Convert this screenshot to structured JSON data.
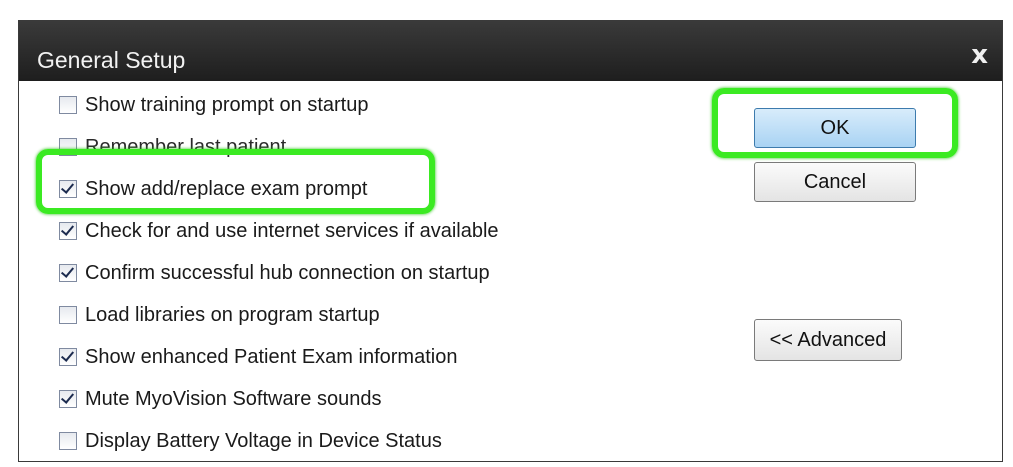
{
  "dialog": {
    "title": "General Setup",
    "close_label": "x"
  },
  "options": [
    {
      "label": "Show training prompt on startup",
      "checked": false
    },
    {
      "label": "Remember last patient",
      "checked": false
    },
    {
      "label": "Show add/replace exam prompt",
      "checked": true
    },
    {
      "label": "Check for and use internet services if available",
      "checked": true
    },
    {
      "label": "Confirm successful hub connection on startup",
      "checked": true
    },
    {
      "label": "Load libraries on program startup",
      "checked": false
    },
    {
      "label": "Show enhanced Patient Exam information",
      "checked": true
    },
    {
      "label": "Mute MyoVision Software sounds",
      "checked": true
    },
    {
      "label": "Display Battery Voltage in Device Status",
      "checked": false
    }
  ],
  "buttons": {
    "ok_label": "OK",
    "cancel_label": "Cancel",
    "advanced_label": "<< Advanced"
  },
  "colors": {
    "highlight": "#3bea22",
    "titlebar": "#2b2b2b",
    "ok_button": "#a9d3f3"
  }
}
